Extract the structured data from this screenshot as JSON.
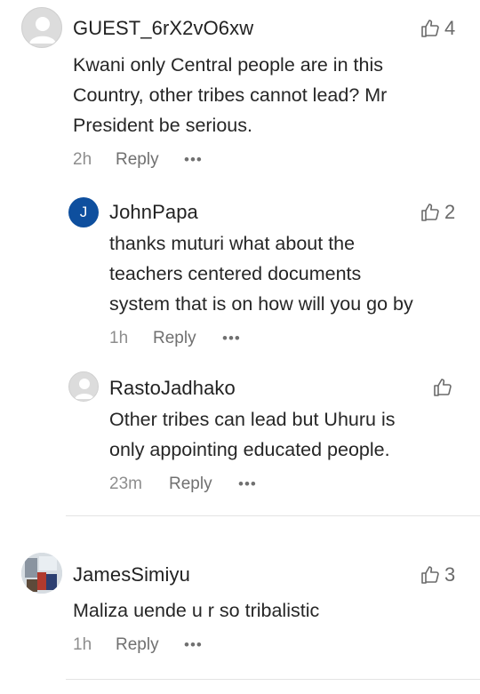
{
  "comments": [
    {
      "username": "GUEST_6rX2vO6xw",
      "lines": [
        "Kwani only Central people are in this",
        "Country, other tribes cannot lead? Mr",
        "President be serious."
      ],
      "time": "2h",
      "reply": "Reply",
      "more": "•••",
      "likes": "4"
    },
    {
      "avatar_initial": "J",
      "username": "JohnPapa",
      "lines": [
        "thanks muturi what about the",
        "teachers centered documents",
        "system that is on how will you go by"
      ],
      "time": "1h",
      "reply": "Reply",
      "more": "•••",
      "likes": "2"
    },
    {
      "username": "RastoJadhako",
      "lines": [
        "Other tribes can lead but Uhuru is",
        "only appointing educated people."
      ],
      "time": "23m",
      "reply": "Reply",
      "more": "•••",
      "likes": ""
    },
    {
      "username": "JamesSimiyu",
      "lines": [
        "Maliza uende u r so tribalistic"
      ],
      "time": "1h",
      "reply": "Reply",
      "more": "•••",
      "likes": "3"
    }
  ],
  "colors": {
    "initial_avatar": "#0e4f9e",
    "icon": "#6a6a6a"
  },
  "icons": {
    "like": "thumbs-up-icon",
    "more": "more-dots-icon",
    "avatar": "user-silhouette-icon"
  }
}
